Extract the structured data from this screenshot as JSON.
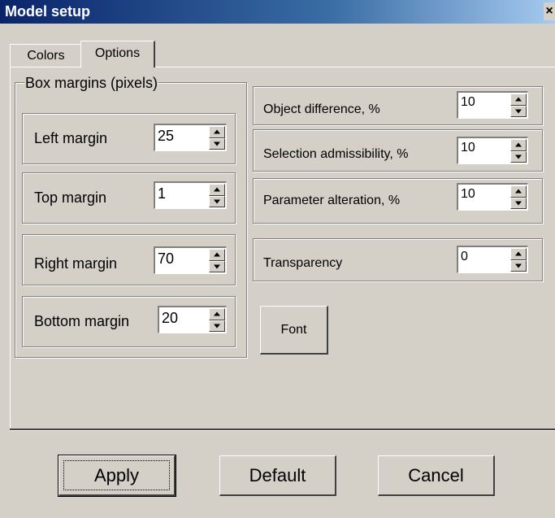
{
  "window": {
    "title": "Model setup",
    "close_glyph": "×"
  },
  "tabs": [
    {
      "label": "Colors",
      "selected": false
    },
    {
      "label": "Options",
      "selected": true
    }
  ],
  "box_margins": {
    "legend": "Box margins (pixels)",
    "fields": [
      {
        "label": "Left margin",
        "value": "25"
      },
      {
        "label": "Top margin",
        "value": "1"
      },
      {
        "label": "Right margin",
        "value": "70"
      },
      {
        "label": "Bottom margin",
        "value": "20"
      }
    ]
  },
  "options": {
    "fields": [
      {
        "label": "Object difference, %",
        "value": "10"
      },
      {
        "label": "Selection admissibility, %",
        "value": "10"
      },
      {
        "label": "Parameter alteration, %",
        "value": "10"
      },
      {
        "label": "Transparency",
        "value": "0"
      }
    ],
    "font_button": "Font"
  },
  "buttons": {
    "apply": "Apply",
    "default": "Default",
    "cancel": "Cancel"
  },
  "colors": {
    "face": "#d4d0c8",
    "title_start": "#0a246a",
    "title_end": "#a6caf0"
  },
  "icons": {
    "spin_up": "triangle-up-icon",
    "spin_down": "triangle-down-icon"
  }
}
